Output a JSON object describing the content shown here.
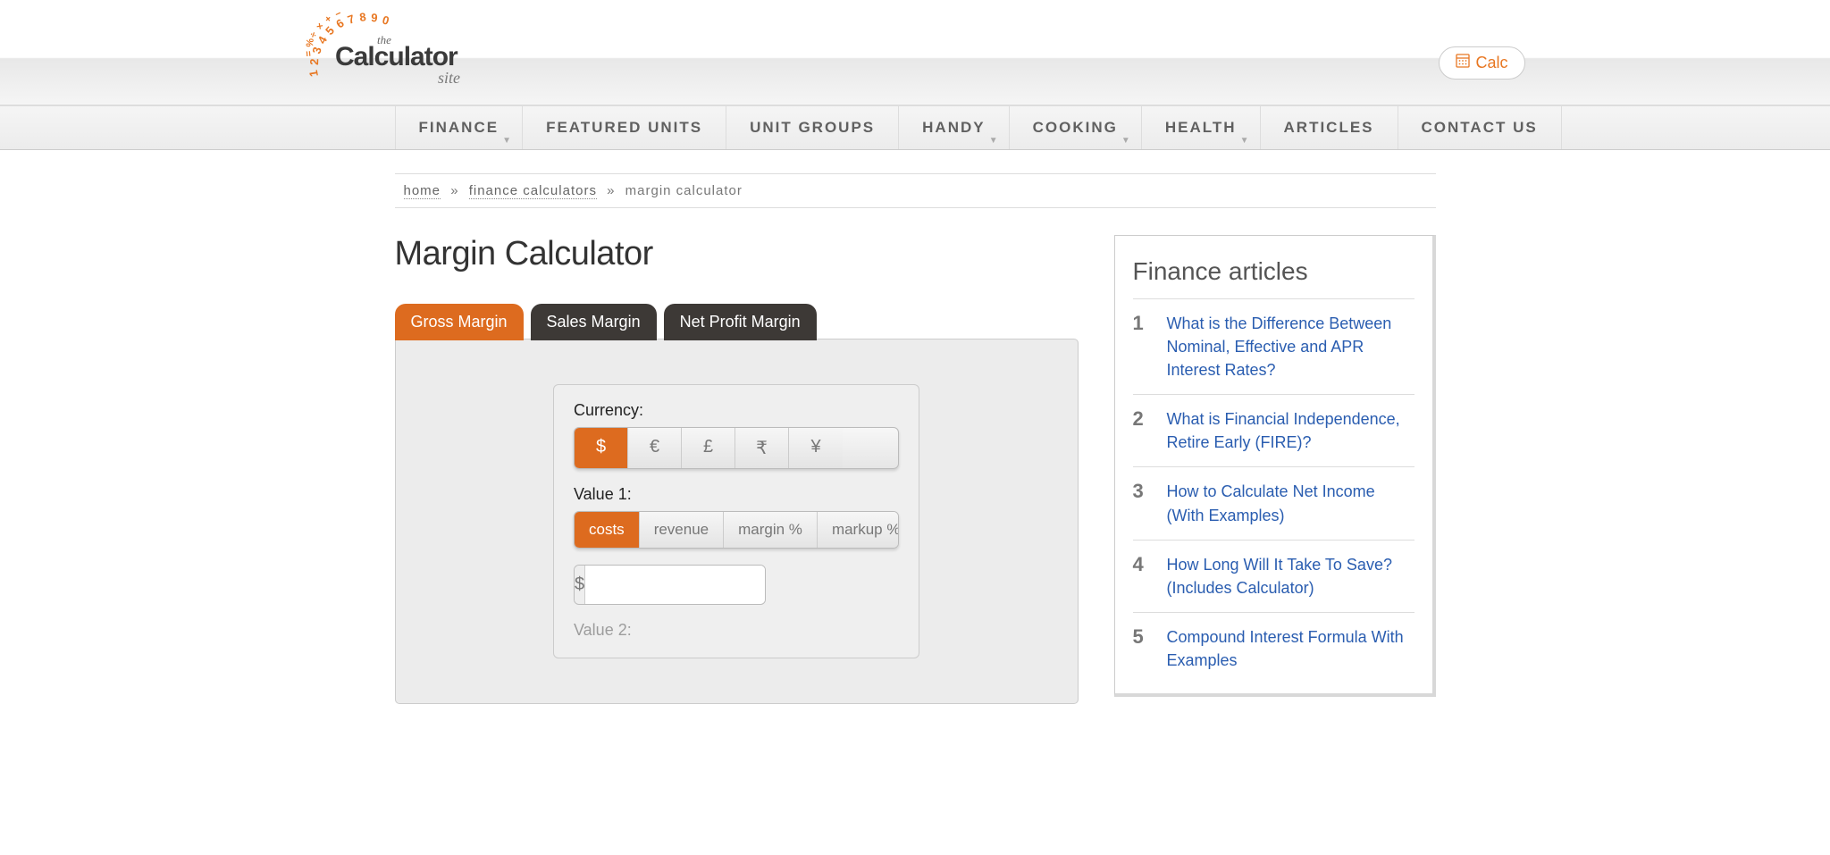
{
  "header": {
    "calc_button": "Calc",
    "logo_the": "the",
    "logo_calc": "Calculator",
    "logo_site": "site"
  },
  "nav": [
    {
      "label": "FINANCE",
      "dropdown": true
    },
    {
      "label": "FEATURED UNITS",
      "dropdown": false
    },
    {
      "label": "UNIT GROUPS",
      "dropdown": false
    },
    {
      "label": "HANDY",
      "dropdown": true
    },
    {
      "label": "COOKING",
      "dropdown": true
    },
    {
      "label": "HEALTH",
      "dropdown": true
    },
    {
      "label": "ARTICLES",
      "dropdown": false
    },
    {
      "label": "CONTACT US",
      "dropdown": false
    }
  ],
  "breadcrumb": {
    "home": "home",
    "fincalc": "finance calculators",
    "current": "margin calculator",
    "sep": "»"
  },
  "page": {
    "title": "Margin Calculator"
  },
  "tabs": [
    {
      "label": "Gross Margin",
      "active": true
    },
    {
      "label": "Sales Margin",
      "active": false
    },
    {
      "label": "Net Profit Margin",
      "active": false
    }
  ],
  "calc": {
    "currency_label": "Currency:",
    "currencies": [
      "$",
      "€",
      "£",
      "₹",
      "¥"
    ],
    "currency_active": 0,
    "value1_label": "Value 1:",
    "value1_options": [
      "costs",
      "revenue",
      "margin %",
      "markup %"
    ],
    "value1_active": 0,
    "value1_prefix": "$",
    "value1_value": "",
    "value2_label": "Value 2:"
  },
  "sidebar": {
    "title": "Finance articles",
    "articles": [
      {
        "n": "1",
        "text": "What is the Difference Between Nominal, Effective and APR Interest Rates?"
      },
      {
        "n": "2",
        "text": "What is Financial Independence, Retire Early (FIRE)?"
      },
      {
        "n": "3",
        "text": "How to Calculate Net Income (With Examples)"
      },
      {
        "n": "4",
        "text": "How Long Will It Take To Save? (Includes Calculator)"
      },
      {
        "n": "5",
        "text": "Compound Interest Formula With Examples"
      }
    ]
  }
}
